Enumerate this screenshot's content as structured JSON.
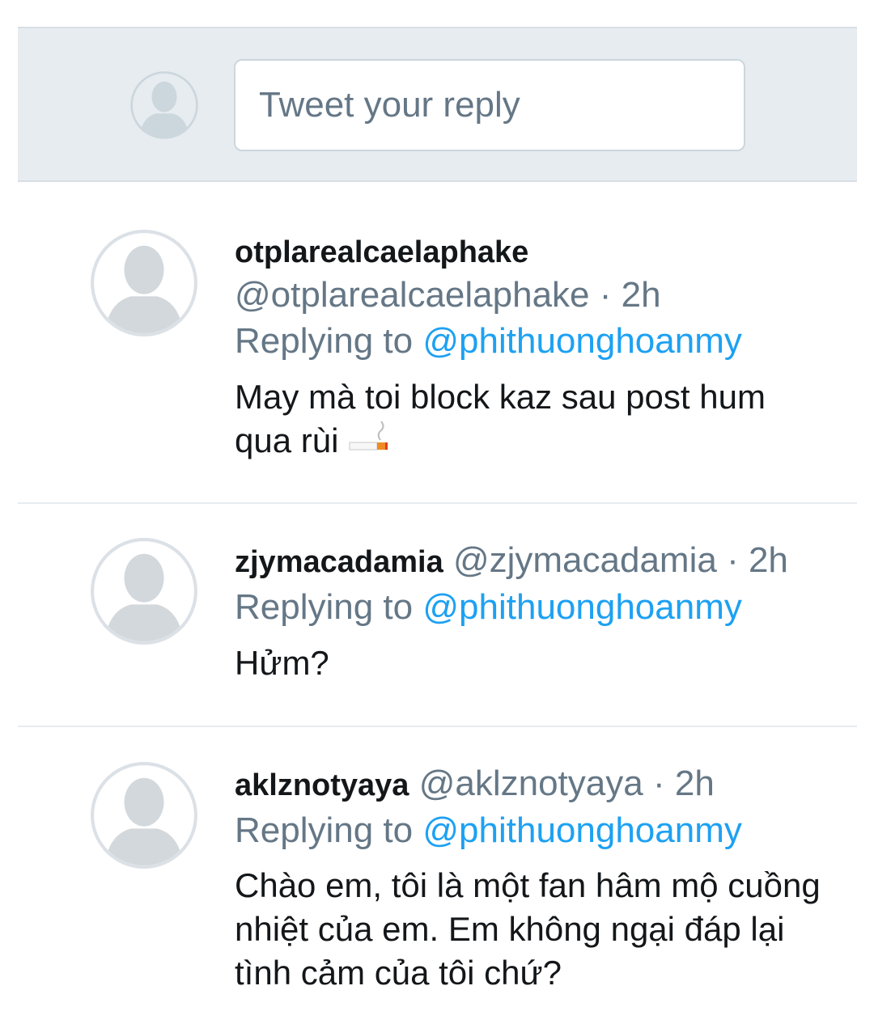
{
  "reply_box": {
    "placeholder": "Tweet your reply"
  },
  "tweets": [
    {
      "name": "otplarealcaelaphake",
      "handle": "@otplarealcaelaphake",
      "sep": "·",
      "time": "2h",
      "replying_label": "Replying to",
      "replying_to": "@phithuonghoanmy",
      "text_line1": "May mà toi block kaz sau post hum",
      "text_line2": "qua rùi",
      "emoji": "cigarette-emoji"
    },
    {
      "name": "zjymacadamia",
      "handle": "@zjymacadamia",
      "sep": "·",
      "time": "2h",
      "replying_label": "Replying to",
      "replying_to": "@phithuonghoanmy",
      "text": "Hửm?"
    },
    {
      "name": "aklznotyaya",
      "handle": "@aklznotyaya",
      "sep": "·",
      "time": "2h",
      "replying_label": "Replying to",
      "replying_to": "@phithuonghoanmy",
      "text_line1": "Chào em, tôi là một fan hâm mộ cuồng",
      "text_line2": "nhiệt của em. Em không ngại đáp lại",
      "text_line3": "tình cảm của tôi chứ?"
    }
  ],
  "colors": {
    "accent": "#1da1f2",
    "secondary_text": "#657786",
    "primary_text": "#14171a",
    "reply_bar_bg": "#e6ecf0"
  }
}
